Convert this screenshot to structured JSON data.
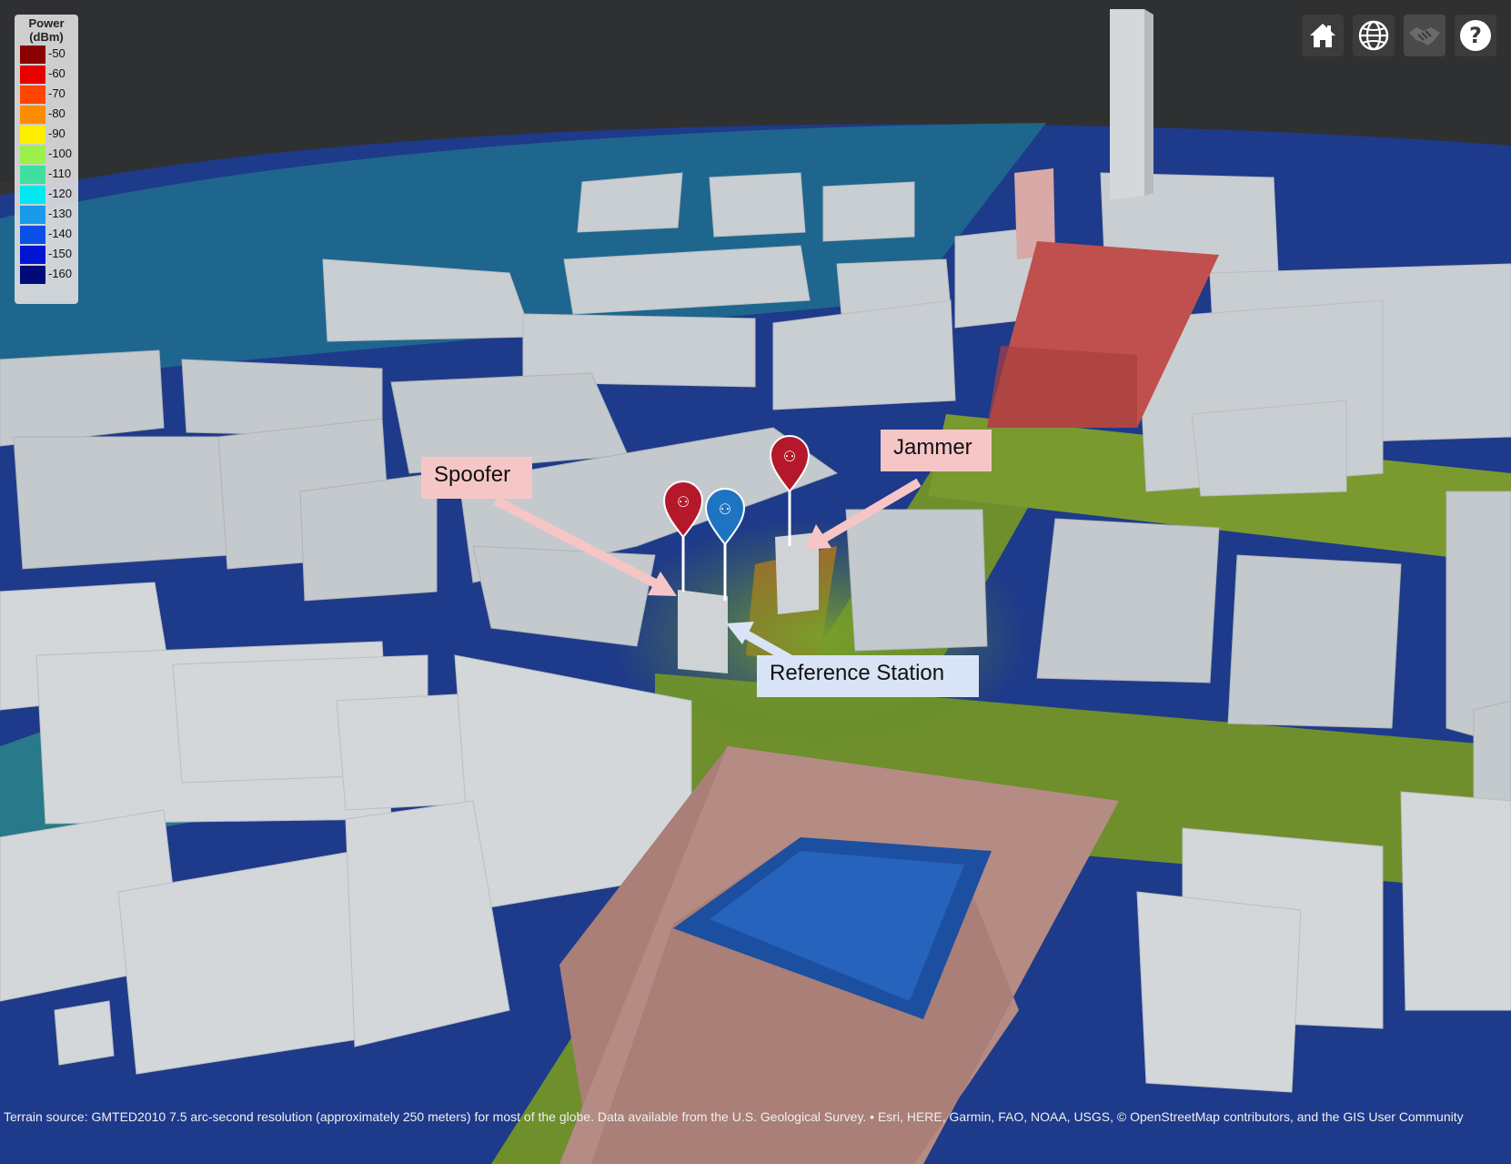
{
  "legend": {
    "title_line1": "Power",
    "title_line2": "(dBm)",
    "entries": [
      {
        "label": "-50",
        "color": "#8b0000"
      },
      {
        "label": "-60",
        "color": "#e60000"
      },
      {
        "label": "-70",
        "color": "#ff4500"
      },
      {
        "label": "-80",
        "color": "#ff8c00"
      },
      {
        "label": "-90",
        "color": "#ffee00"
      },
      {
        "label": "-100",
        "color": "#9cf04a"
      },
      {
        "label": "-110",
        "color": "#3de0a0"
      },
      {
        "label": "-120",
        "color": "#00e8f0"
      },
      {
        "label": "-130",
        "color": "#1a9ae8"
      },
      {
        "label": "-140",
        "color": "#0a50e6"
      },
      {
        "label": "-150",
        "color": "#0014d2"
      },
      {
        "label": "-160",
        "color": "#000a78"
      }
    ]
  },
  "toolbar": {
    "buttons": [
      {
        "name": "home-icon"
      },
      {
        "name": "globe-icon"
      },
      {
        "name": "handshake-icon"
      },
      {
        "name": "help-icon"
      }
    ]
  },
  "markers": {
    "spoofer": {
      "label": "Spoofer",
      "color": "#b5172b"
    },
    "reference": {
      "label": "Reference Station",
      "color": "#1f74c2"
    },
    "jammer": {
      "label": "Jammer",
      "color": "#b5172b"
    }
  },
  "callout_colors": {
    "red_callout": "#f6c6c6",
    "blue_callout": "#d8e4f6"
  },
  "attribution": {
    "text": "Terrain source: GMTED2010 7.5 arc-second resolution (approximately 250 meters) for most of the globe. Data available from the U.S. Geological Survey. • Esri, HERE, Garmin, FAO, NOAA, USGS, © OpenStreetMap contributors, and the GIS User Community"
  }
}
